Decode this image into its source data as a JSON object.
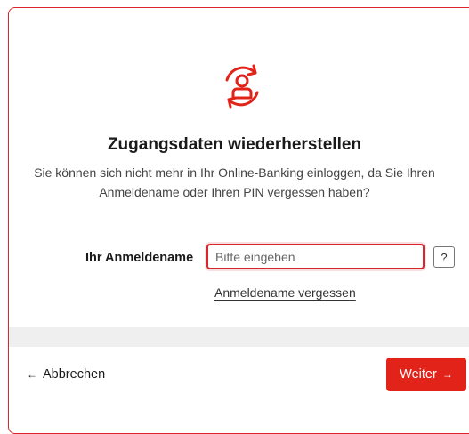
{
  "colors": {
    "accent": "#e2231a",
    "border": "#d9262c"
  },
  "hero": {
    "icon": "account-recovery-icon"
  },
  "title": "Zugangsdaten wiederherstellen",
  "subtitle": "Sie können sich nicht mehr in Ihr Online-Banking einloggen, da Sie Ihren Anmeldename oder Ihren PIN vergessen haben?",
  "form": {
    "username_label": "Ihr Anmeldename",
    "username_placeholder": "Bitte eingeben",
    "username_value": "",
    "help_label": "?",
    "forgot_link": "Anmeldename vergessen"
  },
  "footer": {
    "cancel_arrow": "←",
    "cancel_label": "Abbrechen",
    "next_label": "Weiter",
    "next_arrow": "→"
  }
}
